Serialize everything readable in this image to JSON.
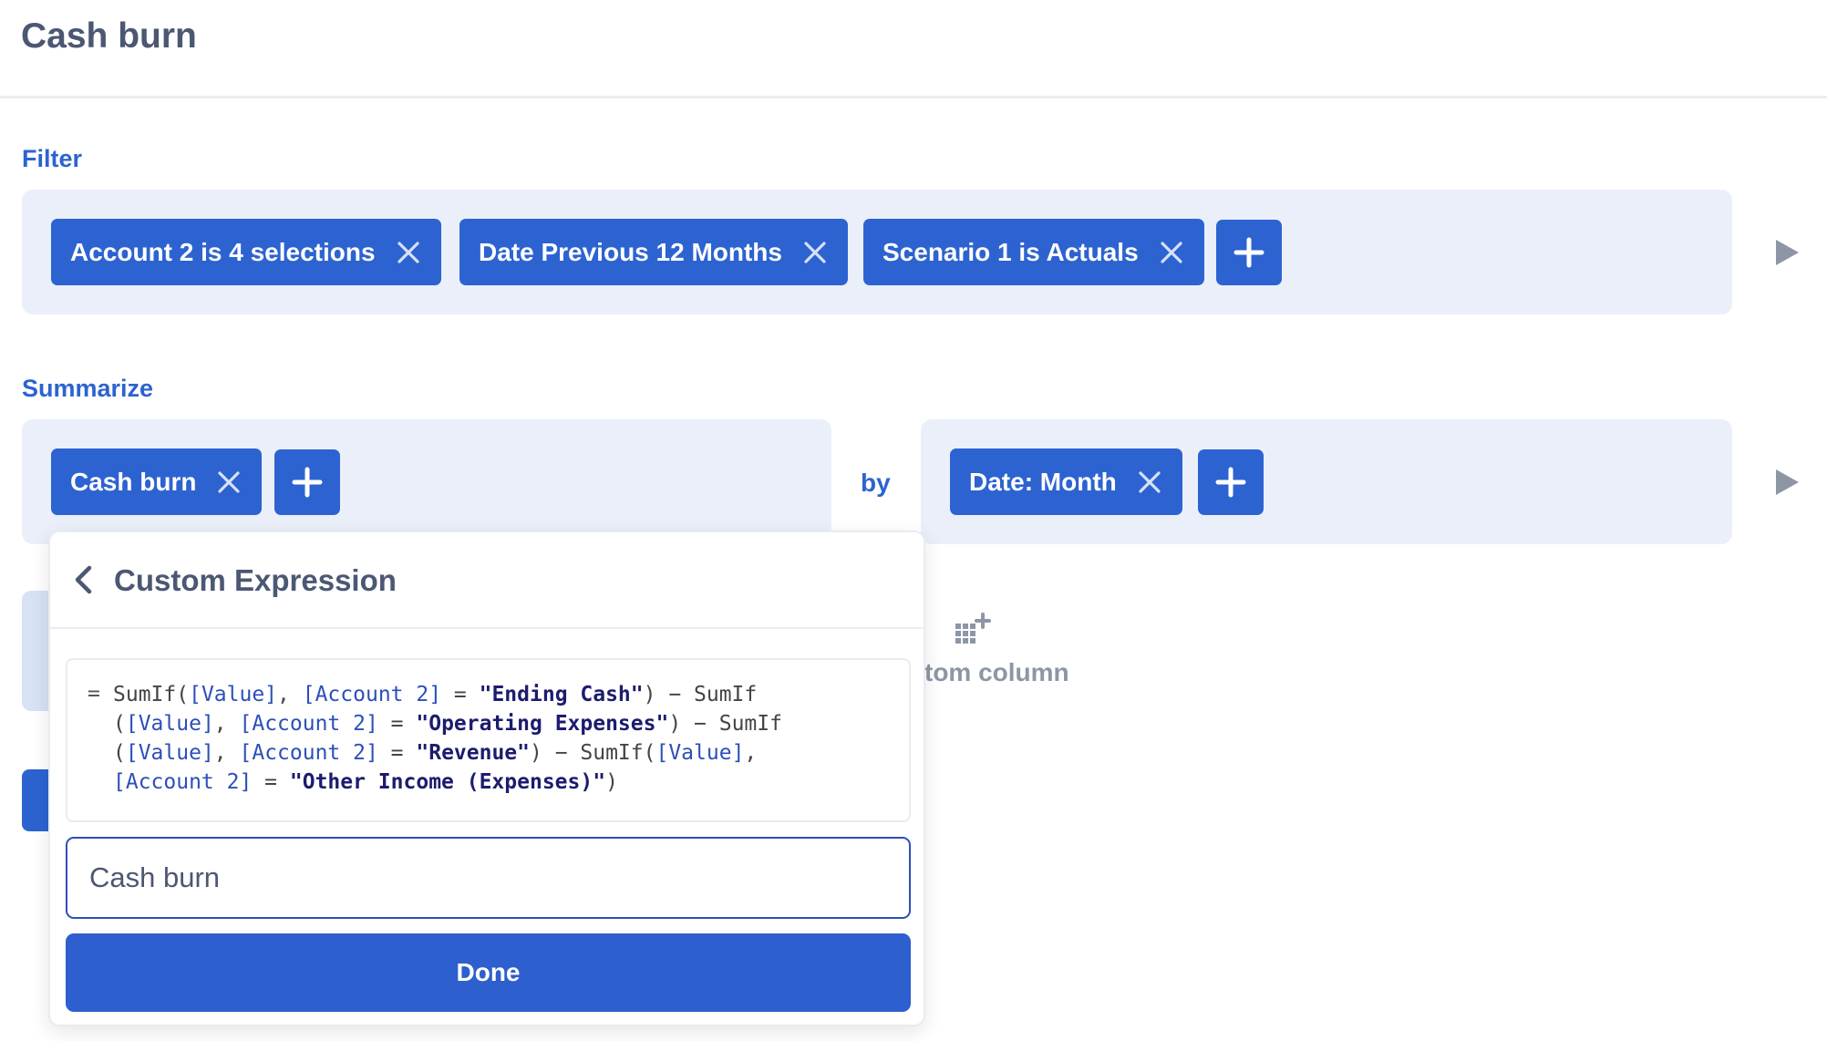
{
  "page": {
    "title": "Cash burn"
  },
  "filter": {
    "label": "Filter",
    "pills": [
      {
        "label": "Account 2 is 4 selections"
      },
      {
        "label": "Date Previous 12 Months"
      },
      {
        "label": "Scenario 1 is Actuals"
      }
    ]
  },
  "summarize": {
    "label": "Summarize",
    "metrics": [
      {
        "label": "Cash burn"
      }
    ],
    "by_label": "by",
    "breakouts": [
      {
        "label": "Date: Month"
      }
    ]
  },
  "custom_column": {
    "label": "tom column"
  },
  "expression_popover": {
    "title": "Custom Expression",
    "equals": "=",
    "expression_lines": [
      [
        [
          "fn",
          "SumIf("
        ],
        [
          "field",
          "[Value]"
        ],
        [
          "op",
          ", "
        ],
        [
          "field",
          "[Account 2]"
        ],
        [
          "op",
          " = "
        ],
        [
          "str",
          "\"Ending Cash\""
        ],
        [
          "op",
          ") − SumIf"
        ]
      ],
      [
        [
          "op",
          "("
        ],
        [
          "field",
          "[Value]"
        ],
        [
          "op",
          ", "
        ],
        [
          "field",
          "[Account 2]"
        ],
        [
          "op",
          " = "
        ],
        [
          "str",
          "\"Operating Expenses\""
        ],
        [
          "op",
          ") − SumIf"
        ]
      ],
      [
        [
          "op",
          "("
        ],
        [
          "field",
          "[Value]"
        ],
        [
          "op",
          ", "
        ],
        [
          "field",
          "[Account 2]"
        ],
        [
          "op",
          " = "
        ],
        [
          "str",
          "\"Revenue\""
        ],
        [
          "op",
          ") − SumIf("
        ],
        [
          "field",
          "[Value]"
        ],
        [
          "op",
          ","
        ]
      ],
      [
        [
          "field",
          "[Account 2]"
        ],
        [
          "op",
          " = "
        ],
        [
          "str",
          "\"Other Income (Expenses)\""
        ],
        [
          "op",
          ")"
        ]
      ]
    ],
    "name_value": "Cash burn",
    "done_label": "Done"
  },
  "colors": {
    "accent": "#2d63d1",
    "step_bg": "#eaeffa",
    "muted": "#8d96a5",
    "text": "#4c5773"
  },
  "icons": [
    "close-icon",
    "plus-icon",
    "play-icon",
    "chevron-left-icon",
    "grid-plus-icon"
  ]
}
